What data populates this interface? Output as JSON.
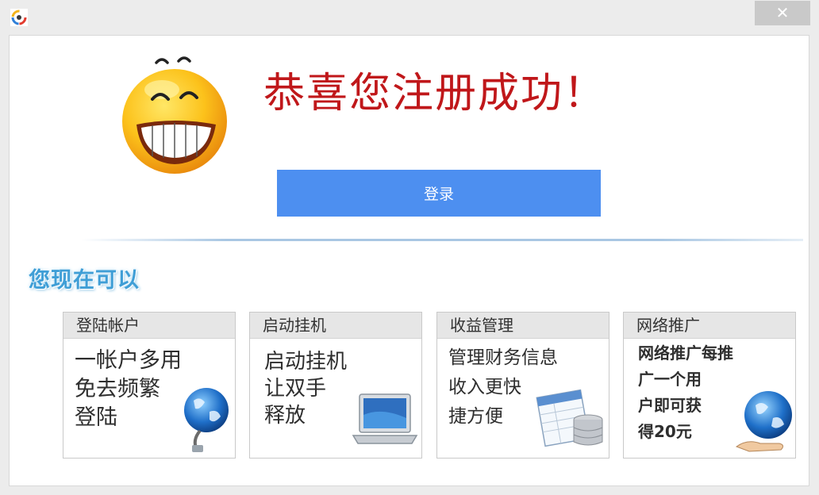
{
  "window": {
    "close_label": "✕"
  },
  "headline": "恭喜您注册成功！",
  "login_button": "登录",
  "section_title": "您现在可以",
  "cards": [
    {
      "title": "登陆帐户",
      "lines": [
        "一帐户多用",
        "免去频繁",
        "登陆"
      ],
      "icon": "globe-network-icon"
    },
    {
      "title": "启动挂机",
      "lines": [
        "启动挂机",
        "让双手",
        "释放"
      ],
      "icon": "laptop-icon"
    },
    {
      "title": "收益管理",
      "lines": [
        "管理财务信息",
        "收入更快",
        "捷方便"
      ],
      "icon": "finance-database-icon"
    },
    {
      "title": "网络推广",
      "lines": [
        "网络推广每推",
        "广一个用",
        "户即可获",
        "得20元"
      ],
      "icon": "globe-hand-icon"
    }
  ],
  "colors": {
    "headline": "#c0171a",
    "login_button": "#4d8ff0",
    "section_title": "#3f9ed6"
  }
}
